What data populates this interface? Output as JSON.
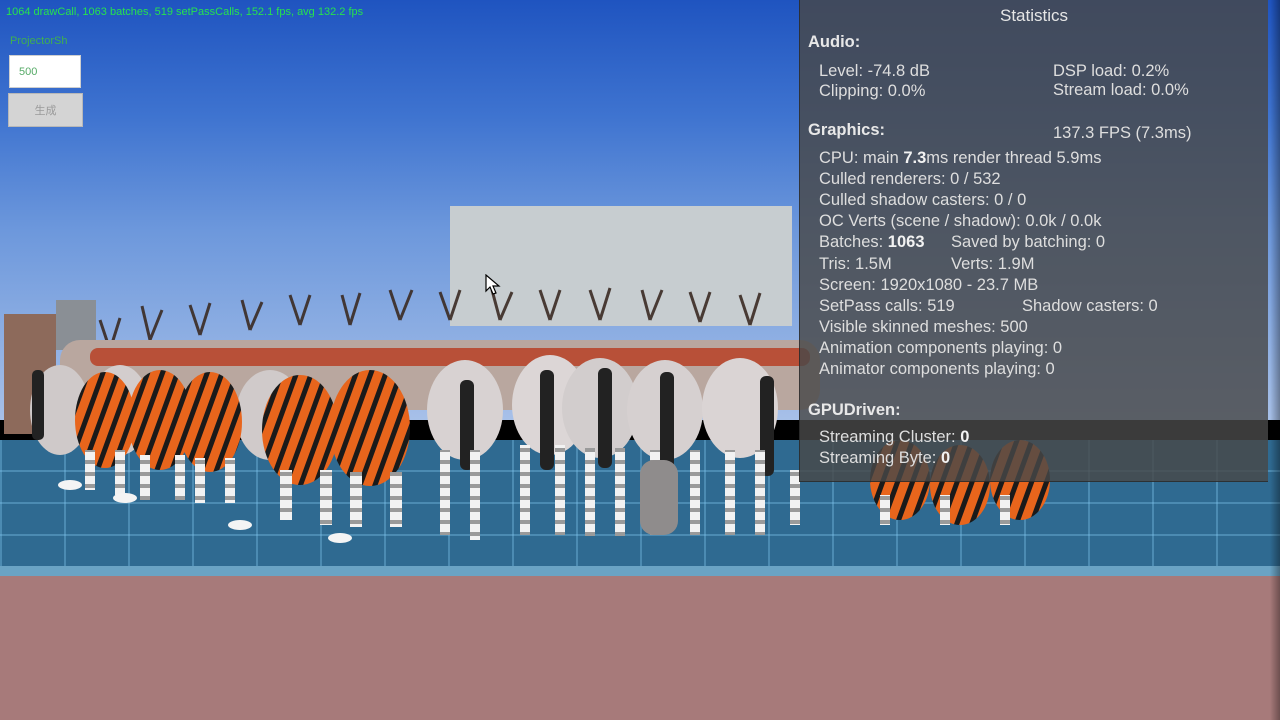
{
  "overlay": {
    "stats_line": "1064 drawCall, 1063 batches, 519 setPassCalls, 152.1 fps, avg 132.2 fps",
    "projector_label": "ProjectorSh",
    "count_input_value": "500",
    "generate_button_label": "生成"
  },
  "stats_panel": {
    "title": "Statistics",
    "audio": {
      "header": "Audio:",
      "level": "Level: -74.8 dB",
      "clipping": "Clipping: 0.0%",
      "dsp_load": "DSP load: 0.2%",
      "stream_load": "Stream load: 0.0%"
    },
    "graphics": {
      "header": "Graphics:",
      "fps": "137.3 FPS (7.3ms)",
      "cpu_prefix": "CPU: main ",
      "cpu_main": "7.3",
      "cpu_suffix": "ms  render thread 5.9ms",
      "culled_renderers": "Culled renderers: 0 / 532",
      "culled_shadow_casters": "Culled shadow casters: 0 / 0",
      "oc_verts": "OC Verts (scene / shadow): 0.0k / 0.0k",
      "batches_prefix": "Batches: ",
      "batches_value": "1063",
      "saved_by_batching": "Saved by batching: 0",
      "tris": "Tris: 1.5M",
      "verts": "Verts: 1.9M",
      "screen": "Screen: 1920x1080 - 23.7 MB",
      "setpass_calls": "SetPass calls: 519",
      "shadow_casters": "Shadow casters: 0",
      "visible_skinned_meshes": "Visible skinned meshes: 500",
      "animation_components": "Animation components playing: 0",
      "animator_components": "Animator components playing: 0"
    },
    "gpudriven": {
      "header": "GPUDriven:",
      "streaming_cluster_label": "Streaming Cluster: ",
      "streaming_cluster_value": "0",
      "streaming_byte_label": "Streaming Byte: ",
      "streaming_byte_value": "0"
    }
  },
  "colors": {
    "overlay_text": "#26e24e",
    "panel_bg": "#484848",
    "sky": "#3f74d0",
    "ground": "#2f6a91",
    "floor": "#a77a7a"
  },
  "icons": [
    "mouse-cursor-icon"
  ]
}
